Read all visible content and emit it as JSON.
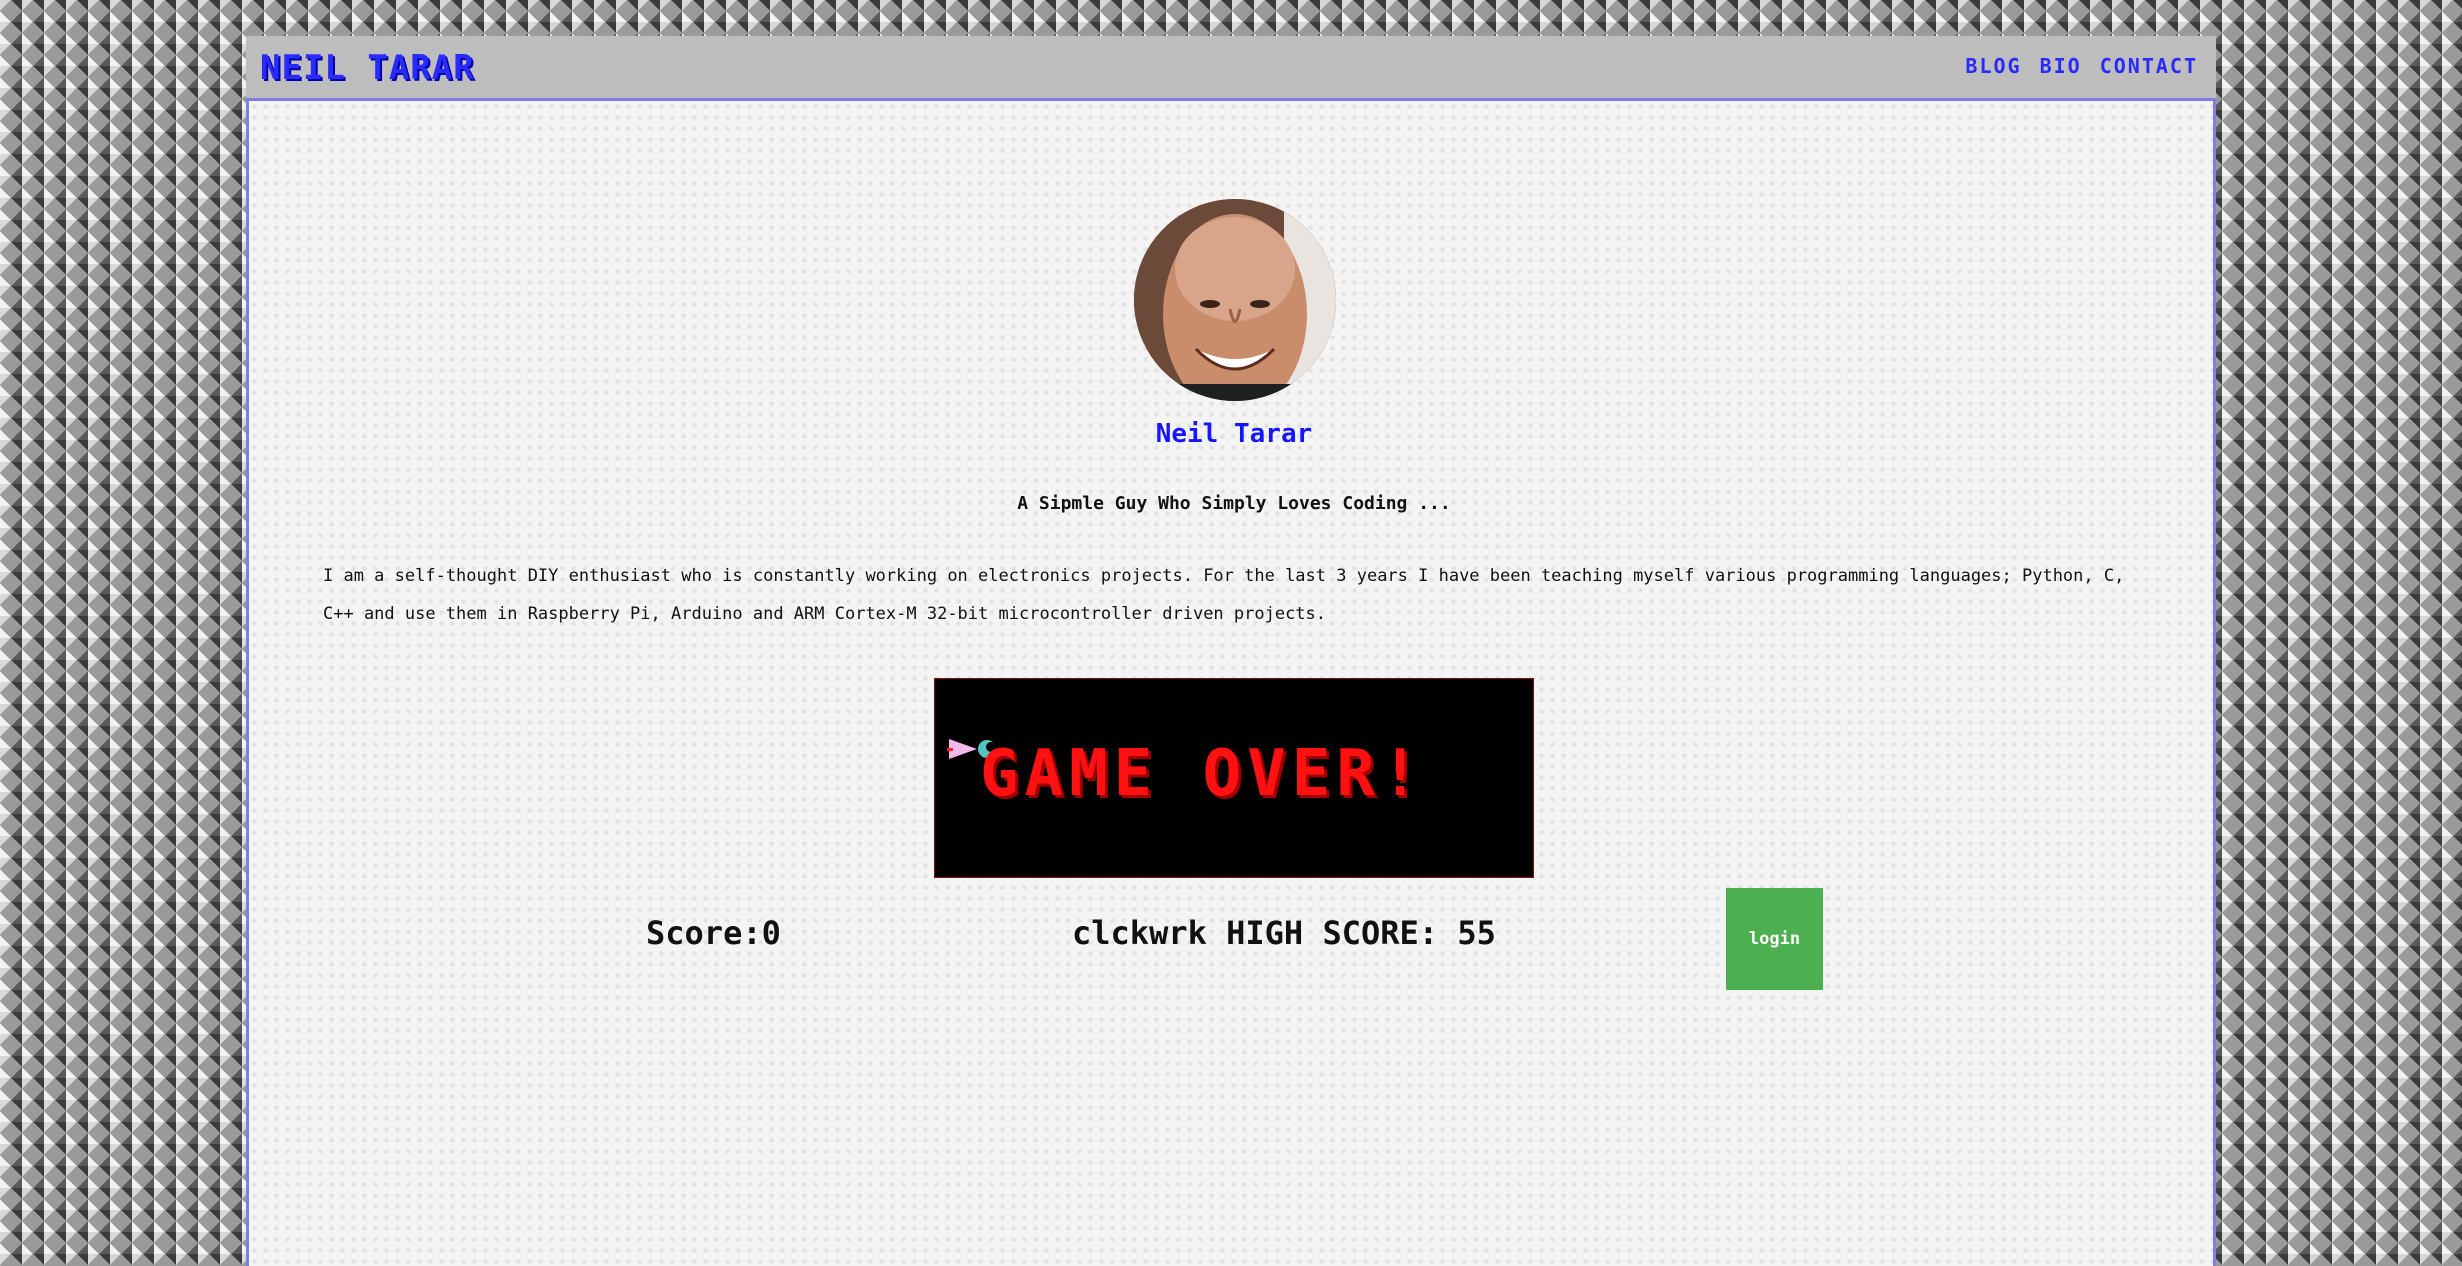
{
  "header": {
    "brand": "NEIL TARAR",
    "nav": [
      "BLOG",
      "BIO",
      "CONTACT"
    ],
    "accent_color": "#2a2aff"
  },
  "profile": {
    "name": "Neil Tarar",
    "tagline": "A Sipmle Guy Who Simply Loves Coding ...",
    "bio": "I am a self-thought DIY enthusiast who is constantly working on electronics projects. For the last 3 years I have been teaching myself various programming languages; Python, C, C++ and use them in Raspberry Pi, Arduino and ARM Cortex-M 32-bit microcontroller driven projects."
  },
  "game": {
    "message": "GAME OVER!",
    "score_text": "Score:0",
    "high_score_text": "clckwrk HIGH SCORE: 55"
  },
  "login": {
    "label": "login",
    "color": "#4caf50"
  }
}
